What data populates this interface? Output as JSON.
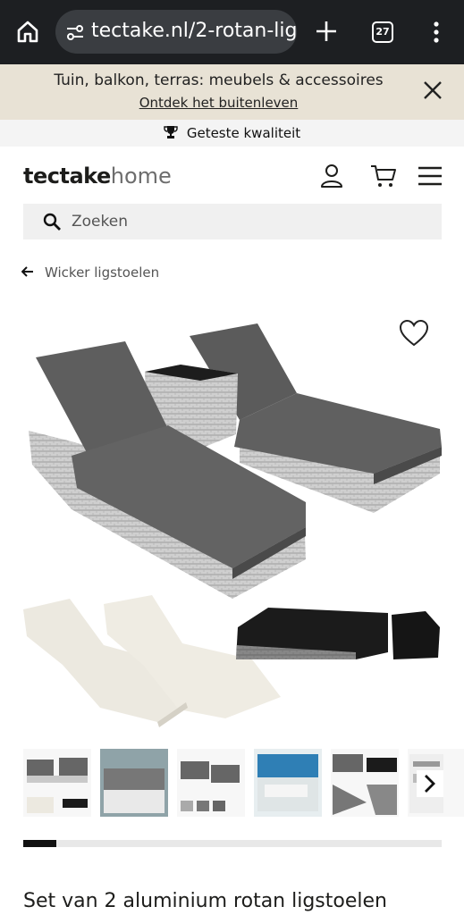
{
  "browser": {
    "url": "tectake.nl/2-rotan-lig",
    "tab_count": "27",
    "icons": [
      "home-icon",
      "site-settings-icon",
      "plus-icon",
      "tabs-icon",
      "more-vert-icon"
    ]
  },
  "promo": {
    "title": "Tuin, balkon, terras: meubels & accessoires",
    "link": "Ontdek het buitenleven",
    "close_icon": "close-icon"
  },
  "quality": {
    "label": "Geteste kwaliteit",
    "icon": "trophy-icon"
  },
  "header": {
    "logo_bold": "tectake",
    "logo_light": "home",
    "icons": [
      "user-icon",
      "cart-icon",
      "hamburger-icon"
    ]
  },
  "search": {
    "placeholder": "Zoeken",
    "value": ""
  },
  "breadcrumb": {
    "back_label": "Wicker ligstoelen"
  },
  "gallery": {
    "thumbnail_count": 6,
    "progress": 0.08,
    "colors": {
      "cushion": "#5e5e5e",
      "wicker": "#c9c9c9",
      "cover": "#1b1b1b",
      "cream": "#ece9e0"
    }
  },
  "product": {
    "title": "Set van 2 aluminium rotan ligstoelen"
  }
}
